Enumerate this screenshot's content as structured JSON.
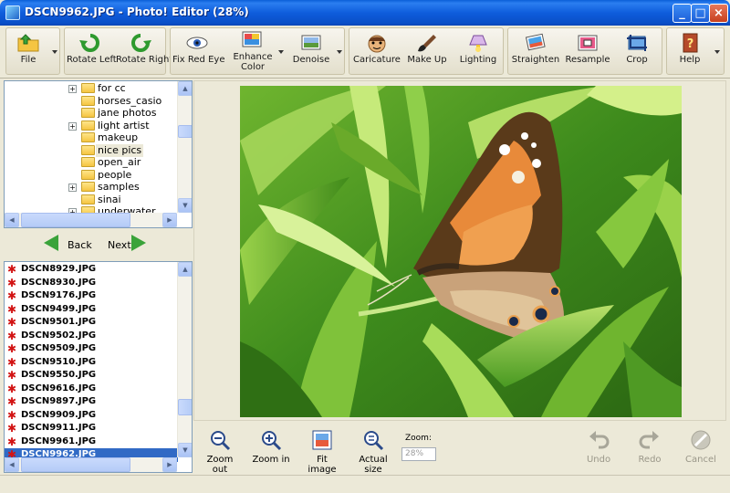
{
  "window": {
    "title": "DSCN9962.JPG - Photo! Editor (28%)",
    "minimize": "_",
    "maximize": "□",
    "close": "×"
  },
  "toolbar": {
    "file": "File",
    "rotate_left": "Rotate Left",
    "rotate_right": "Rotate Right",
    "fix_red_eye": "Fix Red Eye",
    "enhance_color_1": "Enhance",
    "enhance_color_2": "Color",
    "denoise": "Denoise",
    "caricature": "Caricature",
    "make_up": "Make Up",
    "lighting": "Lighting",
    "straighten": "Straighten",
    "resample": "Resample",
    "crop": "Crop",
    "help": "Help"
  },
  "tree": {
    "items": [
      {
        "label": "for cc",
        "expandable": true
      },
      {
        "label": "horses_casio",
        "expandable": false
      },
      {
        "label": "jane photos",
        "expandable": false
      },
      {
        "label": "light artist",
        "expandable": true
      },
      {
        "label": "makeup",
        "expandable": false
      },
      {
        "label": "nice pics",
        "expandable": false,
        "selected": true
      },
      {
        "label": "open_air",
        "expandable": false
      },
      {
        "label": "people",
        "expandable": false
      },
      {
        "label": "samples",
        "expandable": true
      },
      {
        "label": "sinai",
        "expandable": false
      },
      {
        "label": "underwater",
        "expandable": true
      }
    ]
  },
  "nav": {
    "back": "Back",
    "next": "Next"
  },
  "files": {
    "items": [
      "DSCN8929.JPG",
      "DSCN8930.JPG",
      "DSCN9176.JPG",
      "DSCN9499.JPG",
      "DSCN9501.JPG",
      "DSCN9502.JPG",
      "DSCN9509.JPG",
      "DSCN9510.JPG",
      "DSCN9550.JPG",
      "DSCN9616.JPG",
      "DSCN9897.JPG",
      "DSCN9909.JPG",
      "DSCN9911.JPG",
      "DSCN9961.JPG",
      "DSCN9962.JPG"
    ],
    "selected_index": 14
  },
  "bottom": {
    "zoom_out": "Zoom out",
    "zoom_in": "Zoom in",
    "fit_image": "Fit image",
    "actual_size": "Actual size",
    "zoom_label": "Zoom:",
    "zoom_value": "28%",
    "undo": "Undo",
    "redo": "Redo",
    "cancel": "Cancel"
  }
}
